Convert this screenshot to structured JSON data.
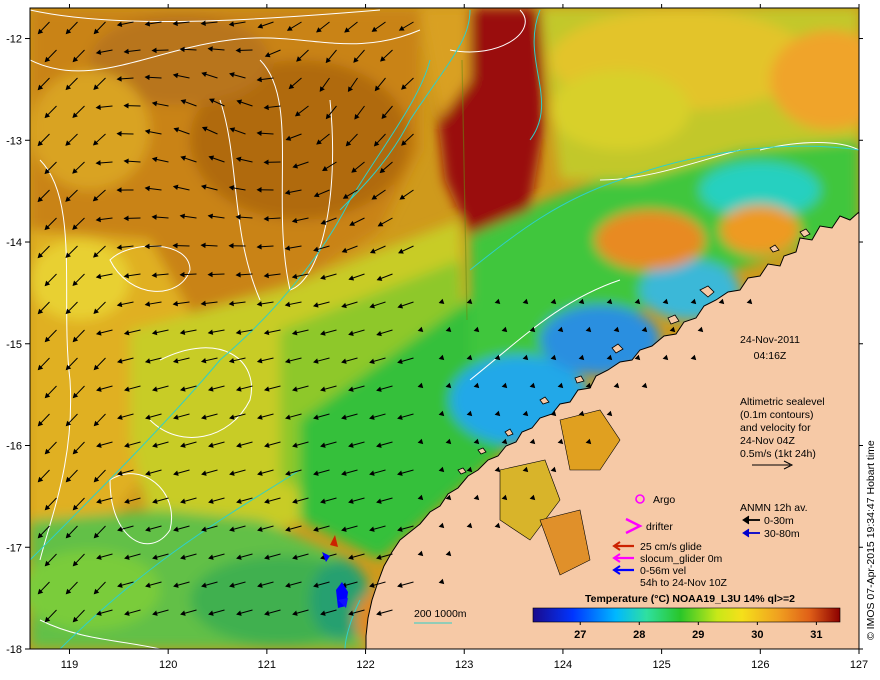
{
  "map": {
    "date": "24-Nov-2011",
    "time": "04:16Z",
    "altimetry_lines": [
      "Altimetric sealevel",
      "(0.1m contours)",
      "and velocity for",
      "24-Nov 04Z",
      "0.5m/s (1kt 24h)"
    ],
    "argo_label": "Argo",
    "drifter_label": "drifter",
    "anmn_title": "ANMN 12h av.",
    "anmn_items": [
      {
        "label": "0-30m",
        "color": "#000000"
      },
      {
        "label": "30-80m",
        "color": "#0000cc"
      }
    ],
    "glider_items": [
      {
        "label": "25 cm/s glide",
        "color": "#cc2200"
      },
      {
        "label": "slocum_glider 0m",
        "color": "#ff00ff"
      },
      {
        "label": "0-56m vel",
        "color": "#0000ff"
      },
      {
        "label": "54h to 24-Nov 10Z",
        "color": ""
      }
    ],
    "isobath_label": "200  1000m",
    "colorbar": {
      "title": "Temperature (°C) NOAA19_L3U 14% ql>=2",
      "ticks": [
        "27",
        "28",
        "29",
        "30",
        "31"
      ],
      "range": [
        26.2,
        31.4
      ]
    },
    "x_ticks": [
      "119",
      "120",
      "121",
      "122",
      "123",
      "124",
      "125",
      "126",
      "127"
    ],
    "y_ticks": [
      "-12",
      "-13",
      "-14",
      "-15",
      "-16",
      "-17",
      "-18"
    ],
    "lon_range": [
      118.6,
      127
    ],
    "lat_range": [
      -18,
      -11.7
    ],
    "credit": "© IMOS 07-Apr-2015 19:34:47 Hobart time",
    "colors": {
      "land": "#f6c9a6",
      "coast": "#000000",
      "contour": "#ffffff",
      "isobath": "#2fd0c8",
      "argo": "#ff00ff",
      "drifter": "#ff00ff"
    }
  }
}
